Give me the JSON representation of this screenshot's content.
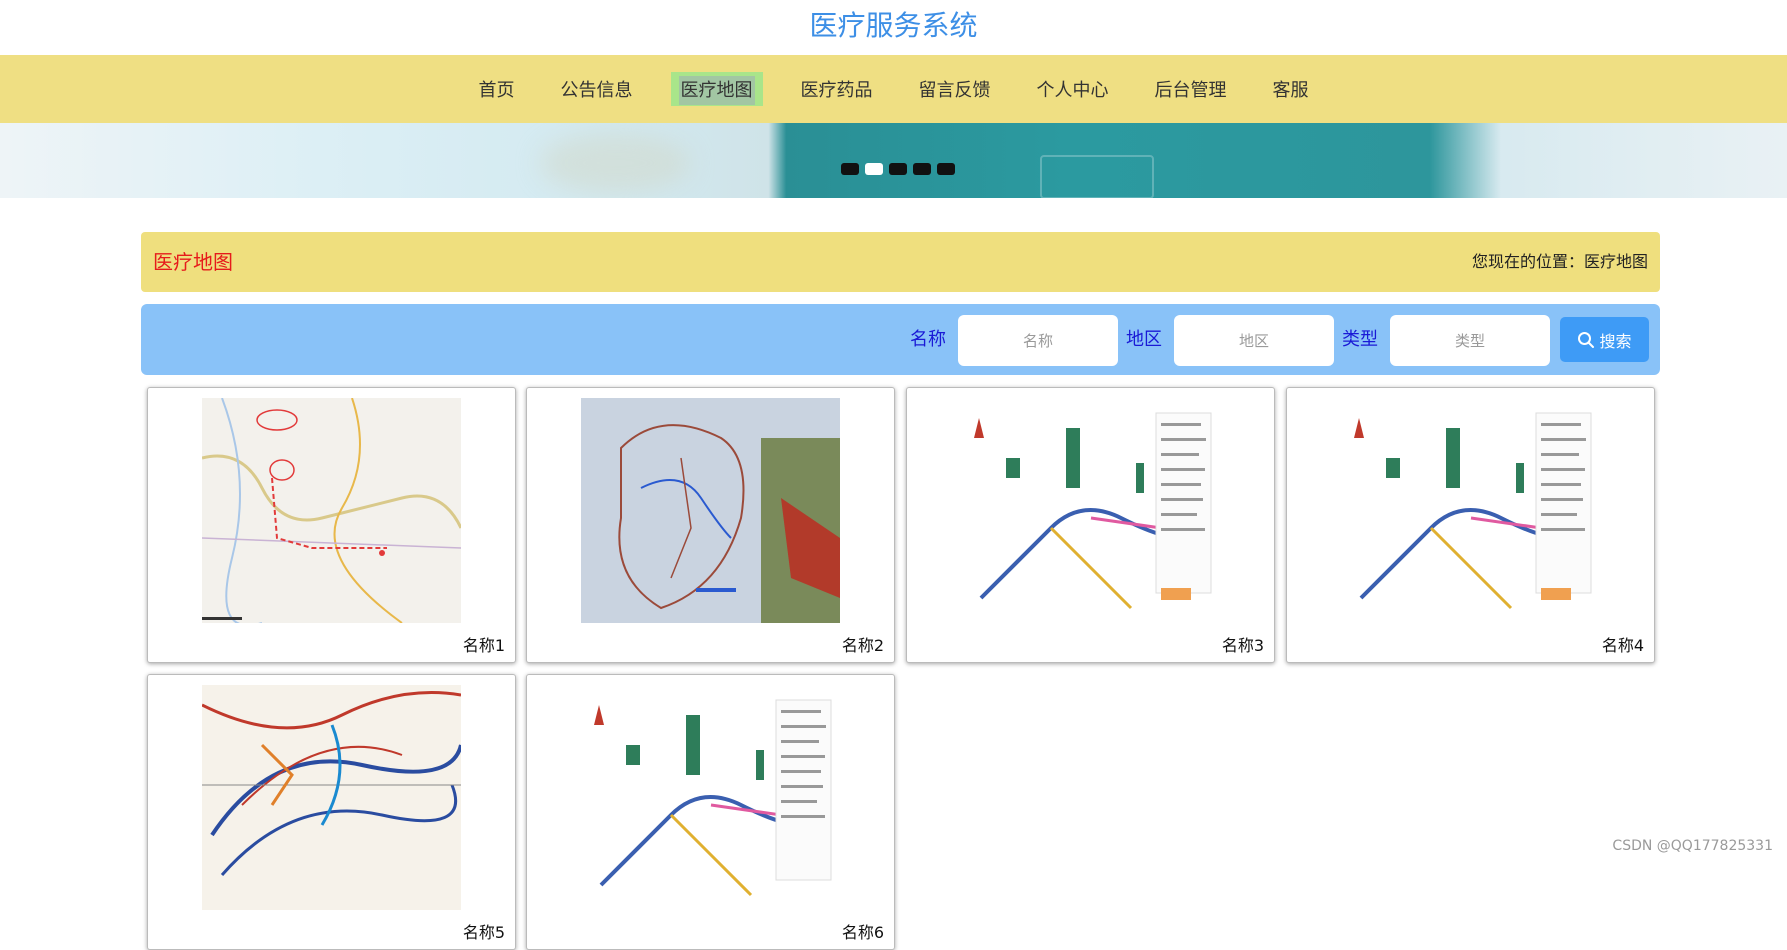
{
  "site": {
    "title": "医疗服务系统"
  },
  "nav": {
    "items": [
      {
        "label": "首页"
      },
      {
        "label": "公告信息"
      },
      {
        "label": "医疗地图"
      },
      {
        "label": "医疗药品"
      },
      {
        "label": "留言反馈"
      },
      {
        "label": "个人中心"
      },
      {
        "label": "后台管理"
      },
      {
        "label": "客服"
      }
    ],
    "active_index": 2
  },
  "carousel": {
    "dot_count": 5,
    "active_dot": 2
  },
  "breadcrumb": {
    "title": "医疗地图",
    "location": "您现在的位置：医疗地图"
  },
  "search": {
    "name_label": "名称",
    "name_placeholder": "名称",
    "region_label": "地区",
    "region_placeholder": "地区",
    "type_label": "类型",
    "type_placeholder": "类型",
    "button_label": "搜索"
  },
  "cards": [
    {
      "name": "名称1",
      "image": "province-road-map"
    },
    {
      "name": "名称2",
      "image": "scenic-area-route-map"
    },
    {
      "name": "名称3",
      "image": "scenic-spot-transit-map"
    },
    {
      "name": "名称4",
      "image": "scenic-spot-transit-map"
    },
    {
      "name": "名称5",
      "image": "historical-route-map"
    },
    {
      "name": "名称6",
      "image": "scenic-spot-transit-map"
    }
  ],
  "watermark": "CSDN @QQ177825331",
  "colors": {
    "title": "#3d8fe6",
    "nav_bg": "#efdf83",
    "search_bg": "#89c2f8",
    "button": "#3e9bf6",
    "crumb_title": "#e61b1b"
  }
}
